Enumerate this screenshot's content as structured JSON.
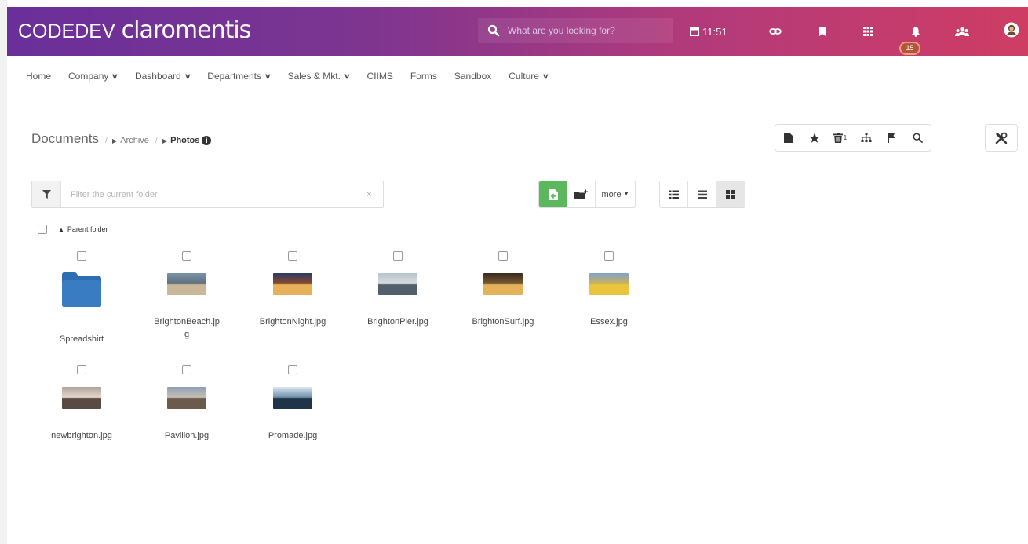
{
  "app": {
    "brand_left": "CODEDEV",
    "brand_right": "claromentis",
    "search_placeholder": "What are you looking for?",
    "time": "11:51",
    "notification_count": "15"
  },
  "nav": [
    {
      "label": "Home",
      "dropdown": false
    },
    {
      "label": "Company",
      "dropdown": true
    },
    {
      "label": "Dashboard",
      "dropdown": true
    },
    {
      "label": "Departments",
      "dropdown": true
    },
    {
      "label": "Sales & Mkt.",
      "dropdown": true
    },
    {
      "label": "CIIMS",
      "dropdown": false
    },
    {
      "label": "Forms",
      "dropdown": false
    },
    {
      "label": "Sandbox",
      "dropdown": false
    },
    {
      "label": "Culture",
      "dropdown": true
    }
  ],
  "breadcrumb": {
    "root": "Documents",
    "sep": "/",
    "archive": "Archive",
    "current": "Photos"
  },
  "toolbar": {
    "recycle_count": "1"
  },
  "filter": {
    "placeholder": "Filter the current folder",
    "clear": "×"
  },
  "actions": {
    "more_label": "more"
  },
  "parent_folder": "Parent folder",
  "items": [
    {
      "name": "Spreadshirt",
      "type": "folder"
    },
    {
      "name": "BrightonBeach.jpg",
      "name_line1": "BrightonBeach.jp",
      "name_line2": "g",
      "type": "photo"
    },
    {
      "name": "BrightonNight.jpg",
      "type": "photo"
    },
    {
      "name": "BrightonPier.jpg",
      "type": "photo"
    },
    {
      "name": "BrightonSurf.jpg",
      "type": "photo"
    },
    {
      "name": "Essex.jpg",
      "type": "photo"
    },
    {
      "name": "newbrighton.jpg",
      "type": "photo"
    },
    {
      "name": "Pavilion.jpg",
      "type": "photo"
    },
    {
      "name": "Promade.jpg",
      "type": "photo"
    }
  ],
  "colors": {
    "topbar_start": "#6a2f9a",
    "topbar_end": "#cf3d64",
    "folder_blue": "#2f6db3",
    "upload_green": "#5cb85c",
    "badge": "#b5543b"
  }
}
